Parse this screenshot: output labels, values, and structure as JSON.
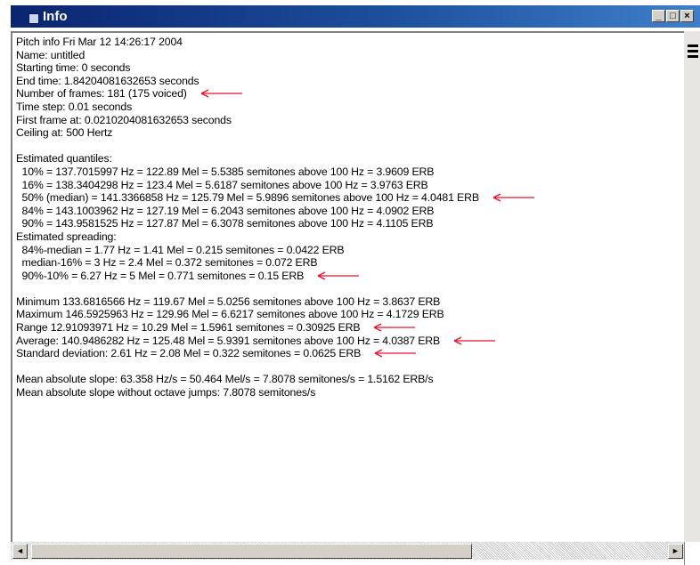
{
  "window": {
    "title": "Info",
    "buttons": {
      "minimize": "_",
      "maximize": "□",
      "close": "×"
    }
  },
  "lines": [
    "Pitch info Fri Mar 12 14:26:17 2004",
    "Name: untitled",
    "Starting time: 0 seconds",
    "End time: 1.84204081632653 seconds",
    "Number of frames: 181 (175 voiced)",
    "Time step: 0.01 seconds",
    "First frame at: 0.0210204081632653 seconds",
    "Ceiling at: 500 Hertz",
    "",
    "Estimated quantiles:",
    "  10% = 137.7015997 Hz = 122.89 Mel = 5.5385 semitones above 100 Hz = 3.9609 ERB",
    "  16% = 138.3404298 Hz = 123.4 Mel = 5.6187 semitones above 100 Hz = 3.9763 ERB",
    "  50% (median) = 141.3366858 Hz = 125.79 Mel = 5.9896 semitones above 100 Hz = 4.0481 ERB",
    "  84% = 143.1003962 Hz = 127.19 Mel = 6.2043 semitones above 100 Hz = 4.0902 ERB",
    "  90% = 143.9581525 Hz = 127.87 Mel = 6.3078 semitones above 100 Hz = 4.1105 ERB",
    "Estimated spreading:",
    "  84%-median = 1.77 Hz = 1.41 Mel = 0.215 semitones = 0.0422 ERB",
    "  median-16% = 3 Hz = 2.4 Mel = 0.372 semitones = 0.072 ERB",
    "  90%-10% = 6.27 Hz = 5 Mel = 0.771 semitones = 0.15 ERB",
    "",
    "Minimum 133.6816566 Hz = 119.67 Mel = 5.0256 semitones above 100 Hz = 3.8637 ERB",
    "Maximum 146.5925963 Hz = 129.96 Mel = 6.6217 semitones above 100 Hz = 4.1729 ERB",
    "Range 12.91093971 Hz = 10.29 Mel = 1.5961 semitones = 0.30925 ERB",
    "Average: 140.9486282 Hz = 125.48 Mel = 5.9391 semitones above 100 Hz = 4.0387 ERB",
    "Standard deviation: 2.61 Hz = 2.08 Mel = 0.322 semitones = 0.0625 ERB",
    "",
    "Mean absolute slope: 63.358 Hz/s = 50.464 Mel/s = 7.8078 semitones/s = 1.5162 ERB/s",
    "Mean absolute slope without octave jumps: 7.8078 semitones/s"
  ],
  "annotations": {
    "arrow_color": "#e8102e",
    "marked_lines": [
      4,
      12,
      18,
      22,
      23,
      24
    ]
  },
  "scrollbar": {
    "left_arrow": "◄",
    "right_arrow": "►"
  }
}
